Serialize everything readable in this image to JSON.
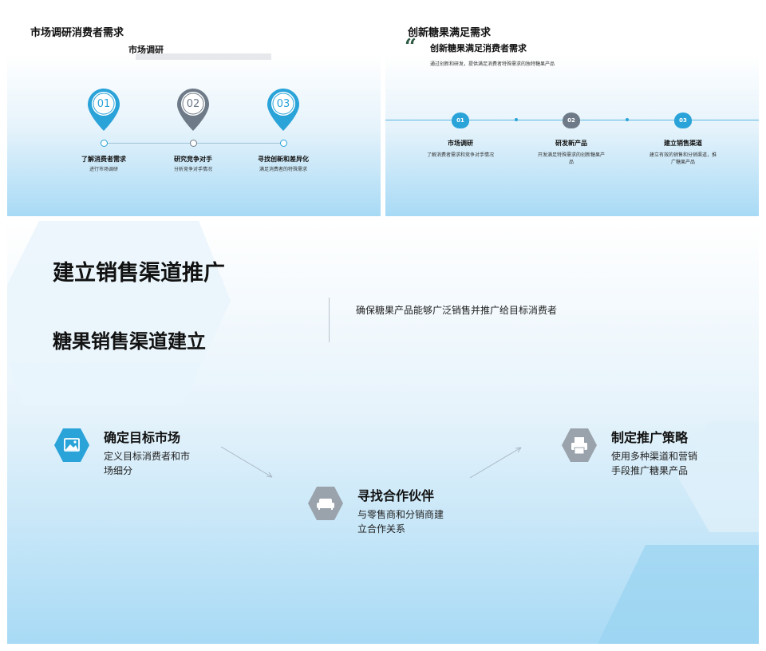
{
  "slide1": {
    "title": "市场调研消费者需求",
    "subtitle": "市场调研",
    "steps": [
      {
        "num": "01",
        "title": "了解消费者需求",
        "desc": "进行市场调研"
      },
      {
        "num": "02",
        "title": "研究竞争对手",
        "desc": "分析竞争对手情况"
      },
      {
        "num": "03",
        "title": "寻找创新和差异化",
        "desc": "满足消费者的特殊需求"
      }
    ],
    "colors": {
      "blue": "#2aa3d9",
      "grey": "#6e7a87"
    }
  },
  "slide2": {
    "title": "创新糖果满足需求",
    "quote_mark": "“",
    "heading": "创新糖果满足消费者需求",
    "description": "通过创新和研发，提供满足消费者特殊需求的独特糖果产品",
    "steps": [
      {
        "num": "01",
        "title": "市场调研",
        "desc": "了解消费者需求和竞争对手情况"
      },
      {
        "num": "02",
        "title": "研发新产品",
        "desc": "开发满足特殊需求的创新糖果产品"
      },
      {
        "num": "03",
        "title": "建立销售渠道",
        "desc": "建立有效的销售和分销渠道，推广糖果产品"
      }
    ]
  },
  "slide3": {
    "title": "建立销售渠道推广",
    "subtitle": "糖果销售渠道建立",
    "intro": "确保糖果产品能够广泛销售并推广给目标消费者",
    "cards": [
      {
        "icon": "image-icon",
        "title": "确定目标市场",
        "desc": "定义目标消费者和市场细分"
      },
      {
        "icon": "sofa-icon",
        "title": "寻找合作伙伴",
        "desc": "与零售商和分销商建立合作关系"
      },
      {
        "icon": "printer-icon",
        "title": "制定推广策略",
        "desc": "使用多种渠道和营销手段推广糖果产品"
      }
    ],
    "colors": {
      "accent": "#2aa3d9",
      "grey": "#9aa3ab"
    }
  }
}
